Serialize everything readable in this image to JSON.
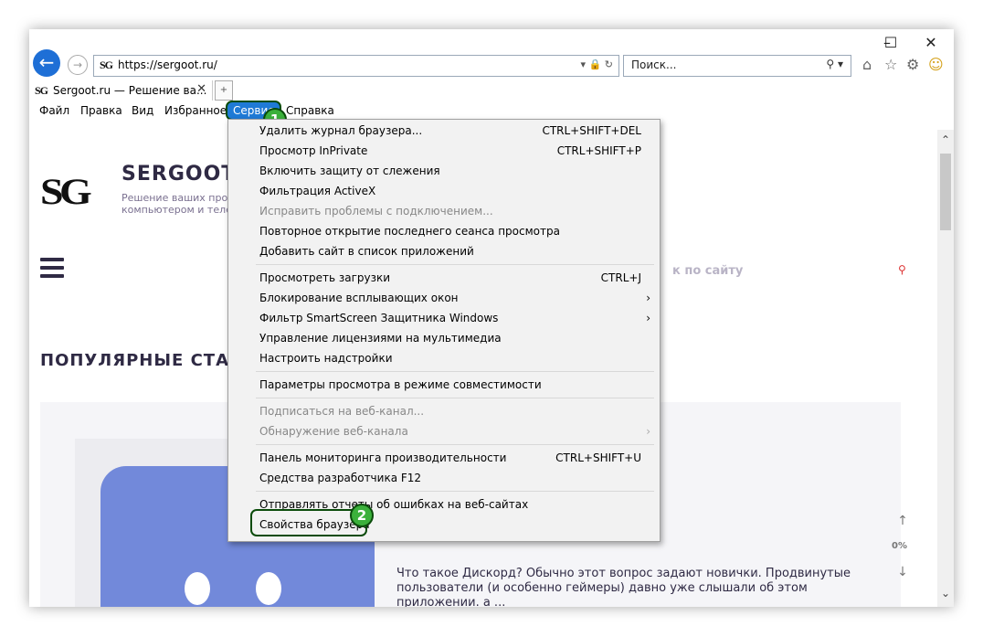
{
  "address_bar": {
    "url": "https://sergoot.ru/",
    "favicon": "SG",
    "icons": [
      "dropdown-icon",
      "lock-icon",
      "refresh-icon"
    ]
  },
  "search_box": {
    "placeholder": "Поиск..."
  },
  "tab": {
    "title": "Sergoot.ru — Решение ва...",
    "close": "✕"
  },
  "menubar": {
    "items": [
      {
        "label": "Файл"
      },
      {
        "label": "Правка"
      },
      {
        "label": "Вид"
      },
      {
        "label": "Избранное"
      },
      {
        "label": "Сервис"
      },
      {
        "label": "Справка"
      }
    ]
  },
  "site": {
    "logo": "SG",
    "title": "SERGOOT",
    "tagline": "Решение ваших про компьютером и теле",
    "search_placeholder": "к по сайту",
    "popular_heading": "ПОПУЛЯРНЫЕ СТА",
    "card": {
      "title": "Discord",
      "text": "Что такое Дискорд? Обычно этот вопрос задают новички. Продвинутые пользователи (и особенно геймеры) давно уже слышали об этом приложении. а ..."
    },
    "scroll_percent": "0%"
  },
  "dropdown": {
    "items": [
      {
        "label": "Удалить журнал браузера...",
        "shortcut": "CTRL+SHIFT+DEL",
        "disabled": false
      },
      {
        "label": "Просмотр InPrivate",
        "shortcut": "CTRL+SHIFT+P",
        "disabled": false
      },
      {
        "label": "Включить защиту от слежения",
        "shortcut": "",
        "disabled": false
      },
      {
        "label": "Фильтрация ActiveX",
        "shortcut": "",
        "disabled": false
      },
      {
        "label": "Исправить проблемы с подключением...",
        "shortcut": "",
        "disabled": true
      },
      {
        "label": "Повторное открытие последнего сеанса просмотра",
        "shortcut": "",
        "disabled": false
      },
      {
        "label": "Добавить сайт в список приложений",
        "shortcut": "",
        "disabled": false
      },
      {
        "label": "Просмотреть загрузки",
        "shortcut": "CTRL+J",
        "disabled": false
      },
      {
        "label": "Блокирование всплывающих окон",
        "shortcut": "",
        "disabled": false
      },
      {
        "label": "Фильтр SmartScreen Защитника Windows",
        "shortcut": "",
        "disabled": false
      },
      {
        "label": "Управление лицензиями на мультимедиа",
        "shortcut": "",
        "disabled": false
      },
      {
        "label": "Настроить надстройки",
        "shortcut": "",
        "disabled": false
      },
      {
        "label": "Параметры просмотра в режиме совместимости",
        "shortcut": "",
        "disabled": false
      },
      {
        "label": "Подписаться на веб-канал...",
        "shortcut": "",
        "disabled": true
      },
      {
        "label": "Обнаружение веб-канала",
        "shortcut": "",
        "disabled": true
      },
      {
        "label": "Панель мониторинга производительности",
        "shortcut": "CTRL+SHIFT+U",
        "disabled": false
      },
      {
        "label": "Средства разработчика F12",
        "shortcut": "",
        "disabled": false
      },
      {
        "label": "Отправлять отчеты об ошибках на веб-сайтах",
        "shortcut": "",
        "disabled": false
      },
      {
        "label": "Свойства браузера",
        "shortcut": "",
        "disabled": false
      }
    ]
  },
  "annotations": {
    "step1": "1",
    "step2": "2"
  },
  "colors": {
    "accent": "#1f7ad6",
    "highlight_border": "#0a4b0a",
    "badge": "#3bb03b",
    "discord": "#7289da"
  }
}
